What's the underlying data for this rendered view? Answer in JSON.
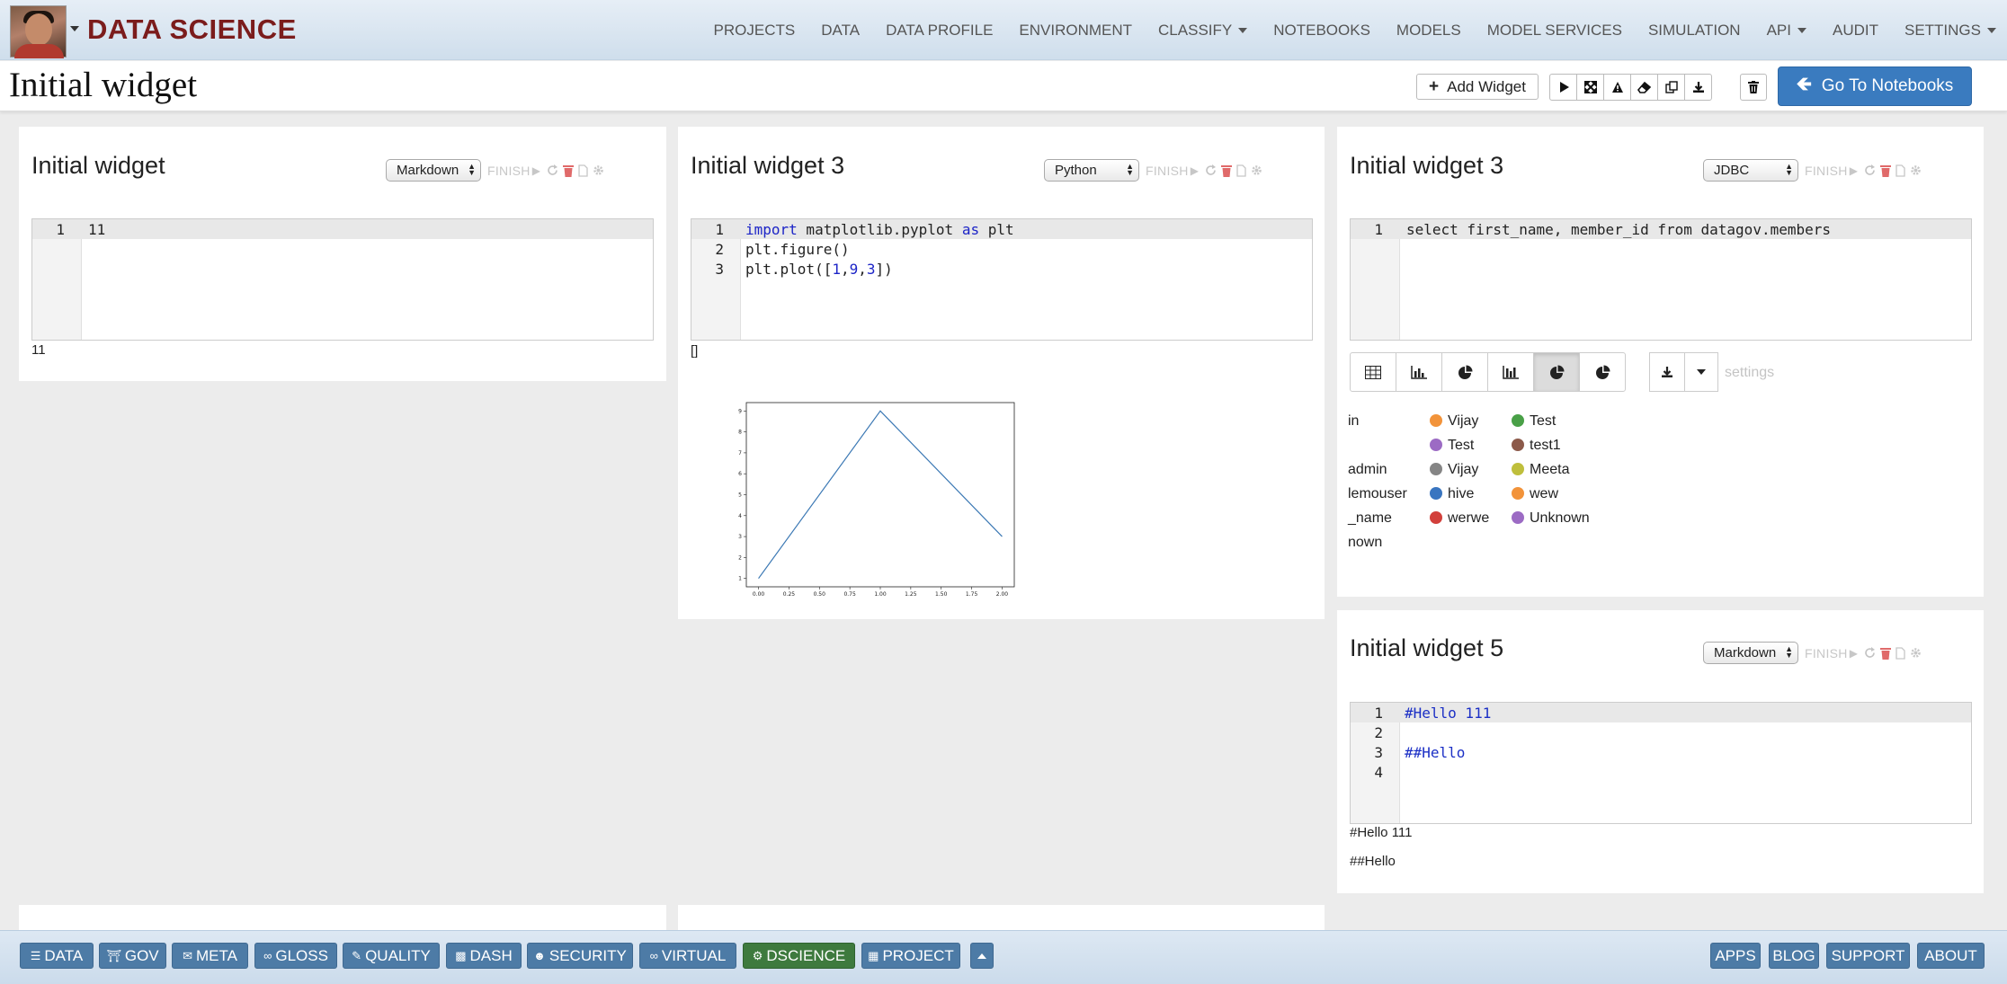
{
  "brand": "DATA SCIENCE",
  "nav": [
    "PROJECTS",
    "DATA",
    "DATA PROFILE",
    "ENVIRONMENT",
    "CLASSIFY",
    "NOTEBOOKS",
    "MODELS",
    "MODEL SERVICES",
    "SIMULATION",
    "API",
    "AUDIT",
    "SETTINGS"
  ],
  "page": {
    "title": "Initial widget",
    "add_widget": "Add Widget",
    "go_to_notebooks": "Go To Notebooks"
  },
  "widgets": {
    "w1": {
      "title": "Initial widget",
      "lang": "Markdown",
      "finish": "FINISH",
      "lines": [
        "1",
        "11"
      ],
      "output": "11"
    },
    "w2": {
      "title": "Initial widget 3",
      "lang": "Python",
      "finish": "FINISH",
      "output": "[]"
    },
    "w3": {
      "title": "Initial widget 3",
      "lang": "JDBC",
      "finish": "FINISH",
      "line_no": "1",
      "code": "select first_name, member_id from datagov.members",
      "settings": "settings"
    },
    "w4": {
      "title": "Initial widget 5",
      "lang": "Markdown",
      "finish": "FINISH",
      "out1": "#Hello 111",
      "out2": "##Hello"
    }
  },
  "python_code": {
    "ln": [
      "1",
      "2",
      "3"
    ],
    "l1_a": "import",
    "l1_b": " matplotlib.pyplot ",
    "l1_c": "as",
    "l1_d": " plt",
    "l2": "plt.figure()",
    "l3_a": "plt.plot([",
    "l3_b": "1",
    "l3_c": ",",
    "l3_d": "9",
    "l3_e": ",",
    "l3_f": "3",
    "l3_g": "])"
  },
  "markdown_code": {
    "ln": [
      "1",
      "2",
      "3",
      "4"
    ],
    "l1": "#Hello 111",
    "l3": "##Hello"
  },
  "chart_data": {
    "type": "line",
    "x": [
      0,
      1,
      2
    ],
    "y": [
      1,
      9,
      3
    ],
    "xticks": [
      "0.00",
      "0.25",
      "0.50",
      "0.75",
      "1.00",
      "1.25",
      "1.50",
      "1.75",
      "2.00"
    ],
    "yticks": [
      "1",
      "2",
      "3",
      "4",
      "5",
      "6",
      "7",
      "8",
      "9"
    ],
    "xlim": [
      -0.1,
      2.1
    ],
    "ylim": [
      0.6,
      9.4
    ],
    "line_color": "#3b78b4"
  },
  "legend": {
    "partial_labels": [
      "in",
      "",
      "admin",
      "lemouser",
      "_name",
      "nown"
    ],
    "col1": [
      {
        "label": "Vijay",
        "color": "#f2933a"
      },
      {
        "label": "Test",
        "color": "#9c6bc4"
      },
      {
        "label": "Vijay",
        "color": "#858585"
      },
      {
        "label": "hive",
        "color": "#3975c0"
      },
      {
        "label": "werwe",
        "color": "#d2403b"
      }
    ],
    "col2": [
      {
        "label": "Test",
        "color": "#49a047"
      },
      {
        "label": "test1",
        "color": "#8c5a4a"
      },
      {
        "label": "Meeta",
        "color": "#bfbf3c"
      },
      {
        "label": "wew",
        "color": "#f2933a"
      },
      {
        "label": "Unknown",
        "color": "#9c6bc4"
      }
    ]
  },
  "bottom": {
    "left": [
      "DATA",
      "GOV",
      "META",
      "GLOSS",
      "QUALITY",
      "DASH",
      "SECURITY",
      "VIRTUAL",
      "DSCIENCE",
      "PROJECT"
    ],
    "right": [
      "APPS",
      "BLOG",
      "SUPPORT",
      "ABOUT"
    ]
  }
}
